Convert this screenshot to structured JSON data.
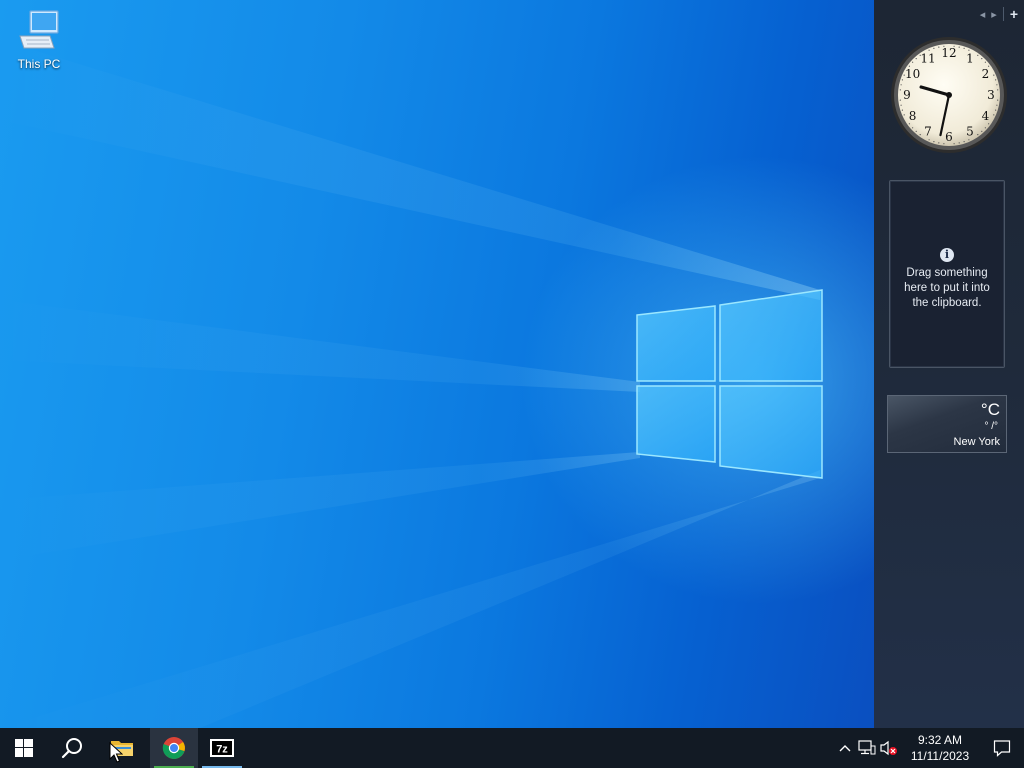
{
  "desktop": {
    "icons": [
      {
        "label": "This PC",
        "icon": "computer-icon"
      }
    ]
  },
  "sidebar": {
    "controls": {
      "prev": "◂",
      "next": "▸",
      "add": "+"
    },
    "clock": {
      "hour": 9,
      "minute": 32
    },
    "clipboard": {
      "info_glyph": "i",
      "text": "Drag something here to put it into the clipboard."
    },
    "weather": {
      "temp_unit": "°C",
      "range": "° /°",
      "city": "New York"
    }
  },
  "taskbar": {
    "apps": [
      {
        "name": "Start",
        "icon": "windows-start-icon"
      },
      {
        "name": "Search",
        "icon": "search-icon"
      },
      {
        "name": "File Explorer",
        "icon": "folder-icon"
      },
      {
        "name": "Google Chrome",
        "icon": "chrome-icon",
        "active": true
      },
      {
        "name": "7-Zip",
        "icon": "7zip-icon",
        "label": "7z",
        "running": true
      }
    ],
    "tray": {
      "chevron": "^",
      "time": "9:32 AM",
      "date": "11/11/2023"
    }
  },
  "colors": {
    "accent": "#0078d7",
    "taskbar": "#121a24",
    "running_indicator": "#76b9ed",
    "chrome_indicator": "#4caf50"
  }
}
